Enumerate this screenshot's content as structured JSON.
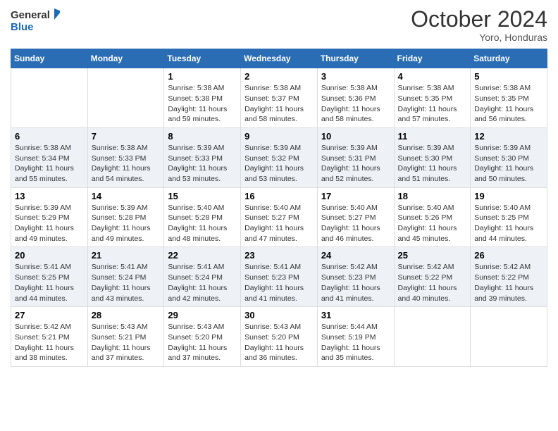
{
  "logo": {
    "line1": "General",
    "line2": "Blue"
  },
  "title": "October 2024",
  "location": "Yoro, Honduras",
  "weekdays": [
    "Sunday",
    "Monday",
    "Tuesday",
    "Wednesday",
    "Thursday",
    "Friday",
    "Saturday"
  ],
  "weeks": [
    [
      {
        "day": "",
        "sunrise": "",
        "sunset": "",
        "daylight": ""
      },
      {
        "day": "",
        "sunrise": "",
        "sunset": "",
        "daylight": ""
      },
      {
        "day": "1",
        "sunrise": "Sunrise: 5:38 AM",
        "sunset": "Sunset: 5:38 PM",
        "daylight": "Daylight: 11 hours and 59 minutes."
      },
      {
        "day": "2",
        "sunrise": "Sunrise: 5:38 AM",
        "sunset": "Sunset: 5:37 PM",
        "daylight": "Daylight: 11 hours and 58 minutes."
      },
      {
        "day": "3",
        "sunrise": "Sunrise: 5:38 AM",
        "sunset": "Sunset: 5:36 PM",
        "daylight": "Daylight: 11 hours and 58 minutes."
      },
      {
        "day": "4",
        "sunrise": "Sunrise: 5:38 AM",
        "sunset": "Sunset: 5:35 PM",
        "daylight": "Daylight: 11 hours and 57 minutes."
      },
      {
        "day": "5",
        "sunrise": "Sunrise: 5:38 AM",
        "sunset": "Sunset: 5:35 PM",
        "daylight": "Daylight: 11 hours and 56 minutes."
      }
    ],
    [
      {
        "day": "6",
        "sunrise": "Sunrise: 5:38 AM",
        "sunset": "Sunset: 5:34 PM",
        "daylight": "Daylight: 11 hours and 55 minutes."
      },
      {
        "day": "7",
        "sunrise": "Sunrise: 5:38 AM",
        "sunset": "Sunset: 5:33 PM",
        "daylight": "Daylight: 11 hours and 54 minutes."
      },
      {
        "day": "8",
        "sunrise": "Sunrise: 5:39 AM",
        "sunset": "Sunset: 5:33 PM",
        "daylight": "Daylight: 11 hours and 53 minutes."
      },
      {
        "day": "9",
        "sunrise": "Sunrise: 5:39 AM",
        "sunset": "Sunset: 5:32 PM",
        "daylight": "Daylight: 11 hours and 53 minutes."
      },
      {
        "day": "10",
        "sunrise": "Sunrise: 5:39 AM",
        "sunset": "Sunset: 5:31 PM",
        "daylight": "Daylight: 11 hours and 52 minutes."
      },
      {
        "day": "11",
        "sunrise": "Sunrise: 5:39 AM",
        "sunset": "Sunset: 5:30 PM",
        "daylight": "Daylight: 11 hours and 51 minutes."
      },
      {
        "day": "12",
        "sunrise": "Sunrise: 5:39 AM",
        "sunset": "Sunset: 5:30 PM",
        "daylight": "Daylight: 11 hours and 50 minutes."
      }
    ],
    [
      {
        "day": "13",
        "sunrise": "Sunrise: 5:39 AM",
        "sunset": "Sunset: 5:29 PM",
        "daylight": "Daylight: 11 hours and 49 minutes."
      },
      {
        "day": "14",
        "sunrise": "Sunrise: 5:39 AM",
        "sunset": "Sunset: 5:28 PM",
        "daylight": "Daylight: 11 hours and 49 minutes."
      },
      {
        "day": "15",
        "sunrise": "Sunrise: 5:40 AM",
        "sunset": "Sunset: 5:28 PM",
        "daylight": "Daylight: 11 hours and 48 minutes."
      },
      {
        "day": "16",
        "sunrise": "Sunrise: 5:40 AM",
        "sunset": "Sunset: 5:27 PM",
        "daylight": "Daylight: 11 hours and 47 minutes."
      },
      {
        "day": "17",
        "sunrise": "Sunrise: 5:40 AM",
        "sunset": "Sunset: 5:27 PM",
        "daylight": "Daylight: 11 hours and 46 minutes."
      },
      {
        "day": "18",
        "sunrise": "Sunrise: 5:40 AM",
        "sunset": "Sunset: 5:26 PM",
        "daylight": "Daylight: 11 hours and 45 minutes."
      },
      {
        "day": "19",
        "sunrise": "Sunrise: 5:40 AM",
        "sunset": "Sunset: 5:25 PM",
        "daylight": "Daylight: 11 hours and 44 minutes."
      }
    ],
    [
      {
        "day": "20",
        "sunrise": "Sunrise: 5:41 AM",
        "sunset": "Sunset: 5:25 PM",
        "daylight": "Daylight: 11 hours and 44 minutes."
      },
      {
        "day": "21",
        "sunrise": "Sunrise: 5:41 AM",
        "sunset": "Sunset: 5:24 PM",
        "daylight": "Daylight: 11 hours and 43 minutes."
      },
      {
        "day": "22",
        "sunrise": "Sunrise: 5:41 AM",
        "sunset": "Sunset: 5:24 PM",
        "daylight": "Daylight: 11 hours and 42 minutes."
      },
      {
        "day": "23",
        "sunrise": "Sunrise: 5:41 AM",
        "sunset": "Sunset: 5:23 PM",
        "daylight": "Daylight: 11 hours and 41 minutes."
      },
      {
        "day": "24",
        "sunrise": "Sunrise: 5:42 AM",
        "sunset": "Sunset: 5:23 PM",
        "daylight": "Daylight: 11 hours and 41 minutes."
      },
      {
        "day": "25",
        "sunrise": "Sunrise: 5:42 AM",
        "sunset": "Sunset: 5:22 PM",
        "daylight": "Daylight: 11 hours and 40 minutes."
      },
      {
        "day": "26",
        "sunrise": "Sunrise: 5:42 AM",
        "sunset": "Sunset: 5:22 PM",
        "daylight": "Daylight: 11 hours and 39 minutes."
      }
    ],
    [
      {
        "day": "27",
        "sunrise": "Sunrise: 5:42 AM",
        "sunset": "Sunset: 5:21 PM",
        "daylight": "Daylight: 11 hours and 38 minutes."
      },
      {
        "day": "28",
        "sunrise": "Sunrise: 5:43 AM",
        "sunset": "Sunset: 5:21 PM",
        "daylight": "Daylight: 11 hours and 37 minutes."
      },
      {
        "day": "29",
        "sunrise": "Sunrise: 5:43 AM",
        "sunset": "Sunset: 5:20 PM",
        "daylight": "Daylight: 11 hours and 37 minutes."
      },
      {
        "day": "30",
        "sunrise": "Sunrise: 5:43 AM",
        "sunset": "Sunset: 5:20 PM",
        "daylight": "Daylight: 11 hours and 36 minutes."
      },
      {
        "day": "31",
        "sunrise": "Sunrise: 5:44 AM",
        "sunset": "Sunset: 5:19 PM",
        "daylight": "Daylight: 11 hours and 35 minutes."
      },
      {
        "day": "",
        "sunrise": "",
        "sunset": "",
        "daylight": ""
      },
      {
        "day": "",
        "sunrise": "",
        "sunset": "",
        "daylight": ""
      }
    ]
  ]
}
